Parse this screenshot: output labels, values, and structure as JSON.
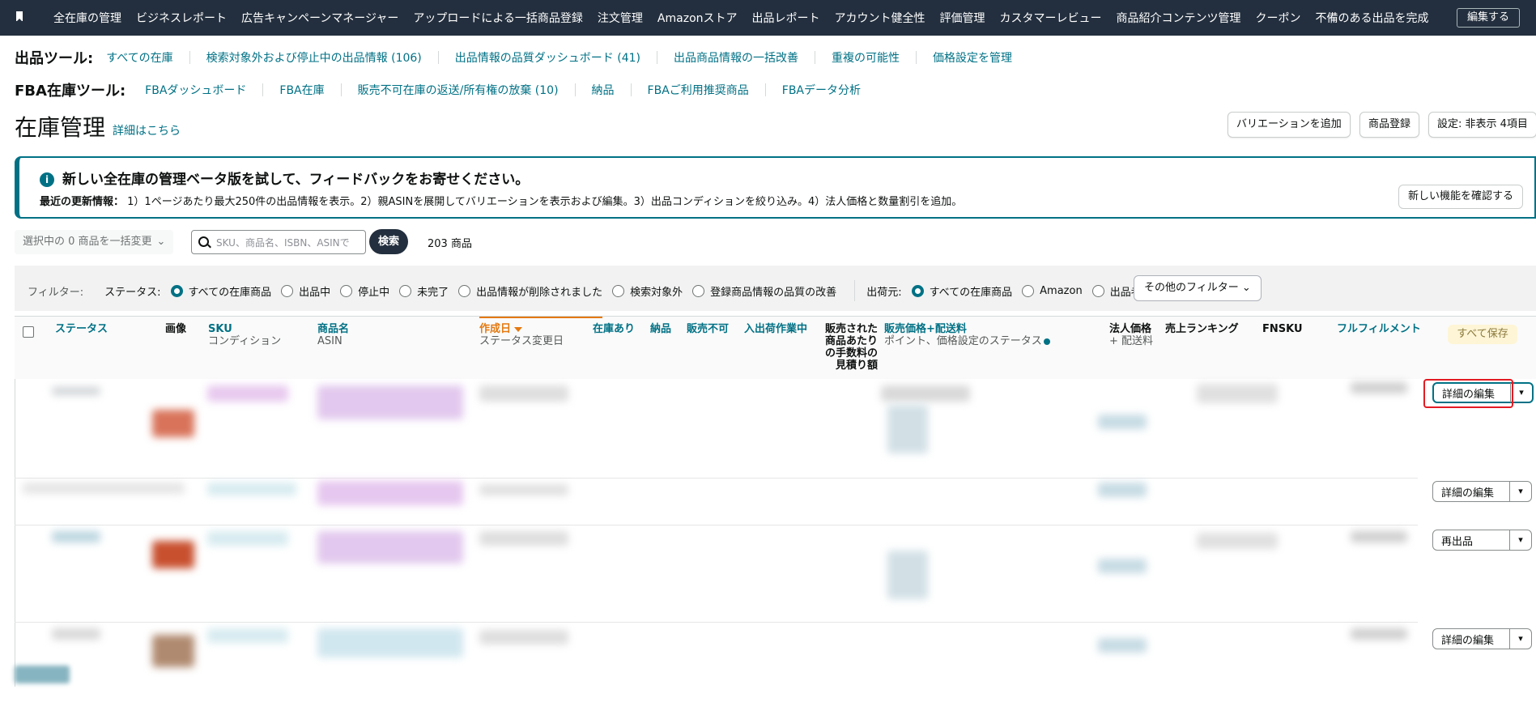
{
  "nav": {
    "bookmark_icon": "bookmark-icon",
    "items": [
      "全在庫の管理",
      "ビジネスレポート",
      "広告キャンペーンマネージャー",
      "アップロードによる一括商品登録",
      "注文管理",
      "Amazonストア",
      "出品レポート",
      "アカウント健全性",
      "評価管理",
      "カスタマーレビュー",
      "商品紹介コンテンツ管理",
      "クーポン",
      "不備のある出品を完成"
    ],
    "edit_label": "編集する"
  },
  "listing_tools": {
    "label": "出品ツール:",
    "links": [
      "すべての在庫",
      "検索対象外および停止中の出品情報 (106)",
      "出品情報の品質ダッシュボード (41)",
      "出品商品情報の一括改善",
      "重複の可能性",
      "価格設定を管理"
    ]
  },
  "fba_tools": {
    "label": "FBA在庫ツール:",
    "links": [
      "FBAダッシュボード",
      "FBA在庫",
      "販売不可在庫の返送/所有権の放棄 (10)",
      "納品",
      "FBAご利用推奨商品",
      "FBAデータ分析"
    ]
  },
  "page": {
    "title": "在庫管理",
    "learn_more": "詳細はこちら",
    "buttons": [
      "バリエーションを追加",
      "商品登録",
      "設定: 非表示 4項目"
    ]
  },
  "banner": {
    "icon": "info-icon",
    "title": "新しい全在庫の管理ベータ版を試して、フィードバックをお寄せください。",
    "text_label": "最近の更新情報：",
    "text": "1）1ページあたり最大250件の出品情報を表示。2）親ASINを展開してバリエーションを表示および編集。3）出品コンディションを絞り込み。4）法人価格と数量割引を追加。",
    "button": "新しい機能を確認する"
  },
  "search": {
    "bulk_label": "選択中の 0 商品を一括変更",
    "placeholder": "SKU、商品名、ISBN、ASINで",
    "button": "検索",
    "count": "203 商品"
  },
  "filters": {
    "label": "フィルター:",
    "status_label": "ステータス:",
    "status_options": [
      "すべての在庫商品",
      "出品中",
      "停止中",
      "未完了",
      "出品情報が削除されました",
      "検索対象外",
      "登録商品情報の品質の改善"
    ],
    "status_selected": 0,
    "fulfillment_label": "出荷元:",
    "fulfillment_options": [
      "すべての在庫商品",
      "Amazon",
      "出品者"
    ],
    "fulfillment_selected": 0,
    "more_filters": "その他のフィルター"
  },
  "table": {
    "headers": {
      "status": "ステータス",
      "image": "画像",
      "sku": "SKU",
      "sku_sub": "コンディション",
      "name": "商品名",
      "name_sub": "ASIN",
      "created": "作成日",
      "created_sub": "ステータス変更日",
      "in_stock": "在庫あり",
      "inbound": "納品",
      "unfulfillable": "販売不可",
      "reserved": "入出荷作業中",
      "fee_l1": "販売された",
      "fee_l2": "商品あたり",
      "fee_l3": "の手数料の",
      "fee_l4": "見積り額",
      "price": "販売価格+配送料",
      "price_sub": "ポイント、価格設定のステータス",
      "business_price": "法人価格",
      "business_price_sub": "+ 配送料",
      "sales_rank": "売上ランキング",
      "fnsku": "FNSKU",
      "fulfillment": "フルフィルメント",
      "save_all": "すべて保存"
    },
    "row_actions": [
      "詳細の編集",
      "詳細の編集",
      "再出品",
      "詳細の編集"
    ]
  }
}
